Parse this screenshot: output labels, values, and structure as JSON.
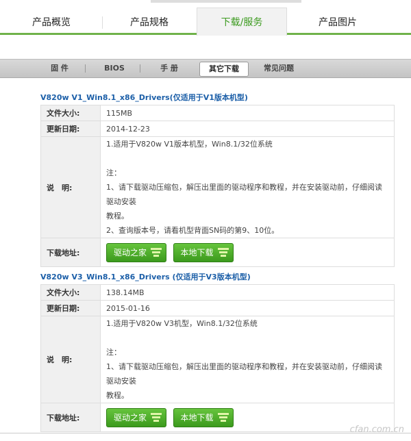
{
  "main_tabs": [
    {
      "label": "产品概览"
    },
    {
      "label": "产品规格"
    },
    {
      "label": "下载/服务",
      "active": true
    },
    {
      "label": "产品图片"
    }
  ],
  "sub_tabs": [
    {
      "label": "固 件"
    },
    {
      "label": "BIOS"
    },
    {
      "label": "手 册"
    },
    {
      "label": "其它下载",
      "active": true
    },
    {
      "label": "常见问题"
    }
  ],
  "downloads": [
    {
      "title": "V820w V1_Win8.1_x86_Drivers(仅适用于V1版本机型)",
      "size_label": "文件大小:",
      "size": "115MB",
      "date_label": "更新日期:",
      "date": "2014-12-23",
      "desc_label": "说　明:",
      "desc_lines": [
        "1.适用于V820w V1版本机型，Win8.1/32位系统",
        "",
        "注：",
        "1、请下载驱动压缩包，解压出里面的驱动程序和教程，并在安装驱动前，仔细阅读驱动安装",
        "教程。",
        "2、查询版本号，请看机型背面SN码的第9、10位。"
      ],
      "dl_label": "下载地址:",
      "buttons": [
        "驱动之家",
        "本地下载"
      ]
    },
    {
      "title": "V820w V3_Win8.1_x86_Drivers (仅适用于V3版本机型)",
      "size_label": "文件大小:",
      "size": "138.14MB",
      "date_label": "更新日期:",
      "date": "2015-01-16",
      "desc_label": "说　明:",
      "desc_lines": [
        "1.适用于V820w V3机型，Win8.1/32位系统",
        "",
        "注：",
        "1、请下载驱动压缩包，解压出里面的驱动程序和教程，并在安装驱动前，仔细阅读驱动安装",
        "教程。"
      ],
      "dl_label": "下载地址:",
      "buttons": [
        "驱动之家",
        "本地下载"
      ]
    }
  ],
  "watermark": "cfan.com.cn",
  "colors": {
    "accent": "#3b9a1e",
    "link": "#1c5fa8",
    "button": "#4aab27"
  }
}
